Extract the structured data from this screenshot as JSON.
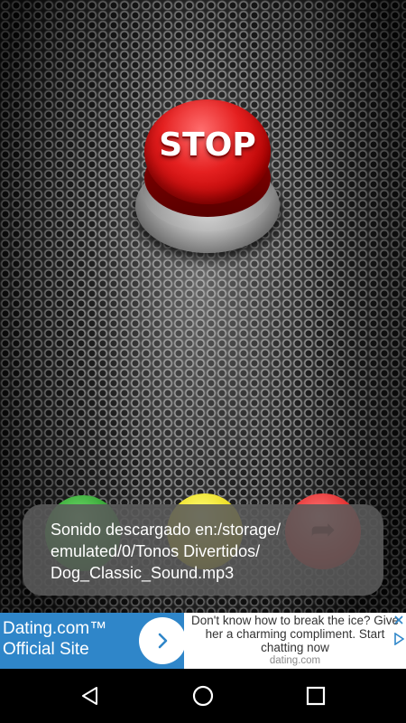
{
  "app": {
    "stop_button": {
      "label": "STOP"
    }
  },
  "toast": {
    "lines": [
      "Sonido descargado en:/storage/",
      "emulated/0/Tonos Divertidos/",
      "Dog_Classic_Sound.mp3"
    ]
  },
  "ad": {
    "brand_lines": [
      "Dating.com™",
      "Official Site"
    ],
    "message_lines": [
      "Don't know how to break the ice? Give",
      "her a charming compliment. Start",
      "chatting now"
    ],
    "domain": "dating.com"
  },
  "navbar": {
    "icons": [
      "back-icon",
      "home-icon",
      "recents-icon"
    ]
  }
}
